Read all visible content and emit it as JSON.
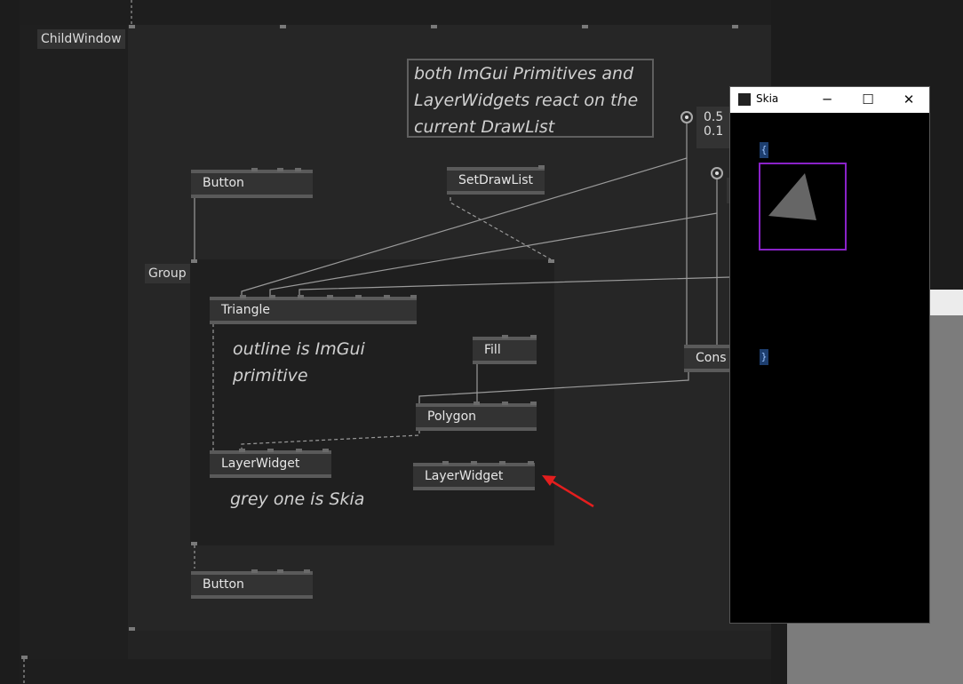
{
  "canvas": {
    "childwindow_label": "ChildWindow",
    "group_label": "Group"
  },
  "nodes": {
    "button_top": "Button",
    "button_bottom": "Button",
    "setdrawlist": "SetDrawList",
    "triangle": "Triangle",
    "fill": "Fill",
    "polygon": "Polygon",
    "layerwidget_left": "LayerWidget",
    "layerwidget_right": "LayerWidget",
    "cons": "Cons"
  },
  "comments": {
    "top": "both ImGui Primitives and LayerWidgets react on the current DrawList",
    "outline": "outline is ImGui primitive",
    "grey": "grey one is Skia"
  },
  "readouts": [
    "0.5",
    "0.1"
  ],
  "skia_window": {
    "title": "Skia",
    "minimize": "─",
    "maximize": "☐",
    "close": "✕",
    "brace_open": "{",
    "brace_close": "}"
  },
  "colors": {
    "accent_purple": "#8a22c8",
    "arrow_red": "#e41e1e",
    "triangle_grey": "#666666"
  }
}
